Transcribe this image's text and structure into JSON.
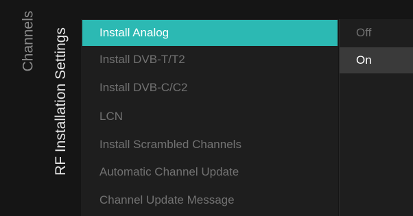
{
  "breadcrumb": {
    "parent": "Channels",
    "current": "RF Installation Settings"
  },
  "menu": {
    "items": [
      {
        "label": "Install Analog",
        "selected": true
      },
      {
        "label": "Install DVB-T/T2",
        "selected": false
      },
      {
        "label": "Install DVB-C/C2",
        "selected": false
      },
      {
        "label": "LCN",
        "selected": false
      },
      {
        "label": "Install Scrambled Channels",
        "selected": false
      },
      {
        "label": "Automatic Channel Update",
        "selected": false
      },
      {
        "label": "Channel Update Message",
        "selected": false
      }
    ]
  },
  "options": {
    "items": [
      {
        "label": "Off",
        "active": false
      },
      {
        "label": "On",
        "active": true
      }
    ]
  },
  "colors": {
    "background": "#151515",
    "panel": "#1e1e1e",
    "highlight": "#2cb9b3",
    "option_active": "#3a3a3a",
    "text_dim": "#727272",
    "text_bright": "#ffffff"
  }
}
